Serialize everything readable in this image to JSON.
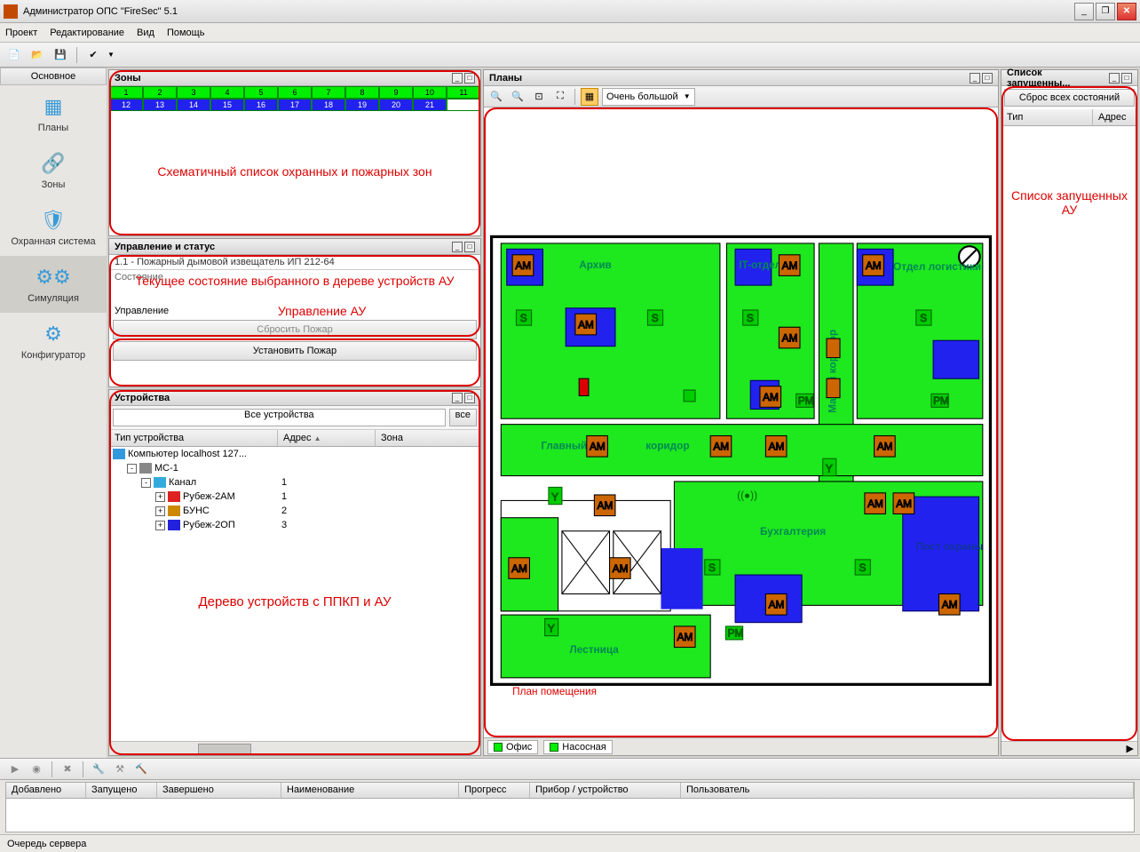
{
  "window": {
    "title": "Администратор ОПС \"FireSec\" 5.1"
  },
  "menu": {
    "project": "Проект",
    "edit": "Редактирование",
    "view": "Вид",
    "help": "Помощь"
  },
  "sidebar": {
    "header": "Основное",
    "items": [
      {
        "label": "Планы"
      },
      {
        "label": "Зоны"
      },
      {
        "label": "Охранная система"
      },
      {
        "label": "Симуляция"
      },
      {
        "label": "Конфигуратор"
      }
    ]
  },
  "zones": {
    "title": "Зоны",
    "row1": [
      "1",
      "2",
      "3",
      "4",
      "5",
      "6",
      "7",
      "8",
      "9",
      "10",
      "11"
    ],
    "row2": [
      "12",
      "13",
      "14",
      "15",
      "16",
      "17",
      "18",
      "19",
      "20",
      "21",
      ""
    ],
    "annotation": "Схематичный список охранных и пожарных зон"
  },
  "control": {
    "title": "Управление и статус",
    "device": "1.1 - Пожарный дымовой извещатель ИП 212-64",
    "state_label": "Состояние",
    "annot1": "Текущее состояние выбранного в дереве устройств АУ",
    "manage_label": "Управление",
    "annot2": "Управление АУ",
    "btn_reset": "Сбросить Пожар",
    "btn_set": "Установить Пожар"
  },
  "devices": {
    "title": "Устройства",
    "filter_placeholder": "Все устройства",
    "filter_btn": "все",
    "cols": {
      "type": "Тип устройства",
      "addr": "Адрес",
      "zone": "Зона"
    },
    "rows": [
      {
        "indent": 0,
        "twisty": "",
        "name": "Компьютер localhost 127...",
        "addr": "",
        "zone": "",
        "iconcolor": "#39d"
      },
      {
        "indent": 1,
        "twisty": "-",
        "name": "МС-1",
        "addr": "",
        "zone": "",
        "iconcolor": "#888"
      },
      {
        "indent": 2,
        "twisty": "-",
        "name": "Канал",
        "addr": "1",
        "zone": "",
        "iconcolor": "#3ad"
      },
      {
        "indent": 3,
        "twisty": "+",
        "name": "Рубеж-2АМ",
        "addr": "1",
        "zone": "",
        "iconcolor": "#d22"
      },
      {
        "indent": 3,
        "twisty": "+",
        "name": "БУНС",
        "addr": "2",
        "zone": "",
        "iconcolor": "#c80"
      },
      {
        "indent": 3,
        "twisty": "+",
        "name": "Рубеж-2ОП",
        "addr": "3",
        "zone": "",
        "iconcolor": "#22d"
      }
    ],
    "annotation": "Дерево устройств с ППКП и АУ"
  },
  "plans": {
    "title": "Планы",
    "zoom": "Очень большой",
    "rooms": {
      "archive": "Архив",
      "it": "IT-отдел",
      "logistics": "Отдел логистики",
      "small_corridor": "Малый коридор",
      "main_corridor": "Главный",
      "main_corridor2": "коридор",
      "accounting": "Бухгалтерия",
      "guard": "Пост охраны",
      "stair": "Лестница"
    },
    "annotation": "План помещения",
    "tabs": [
      "Офис",
      "Насосная"
    ]
  },
  "launched": {
    "title": "Список запущенны...",
    "reset_btn": "Сброс всех состояний",
    "cols": {
      "type": "Тип",
      "addr": "Адрес"
    },
    "annotation": "Список запущенных АУ"
  },
  "bottom": {
    "cols": {
      "added": "Добавлено",
      "running": "Запущено",
      "done": "Завершено",
      "name": "Наименование",
      "progress": "Прогресс",
      "device": "Прибор / устройство",
      "user": "Пользователь"
    }
  },
  "statusbar": {
    "label": "Очередь сервера"
  }
}
